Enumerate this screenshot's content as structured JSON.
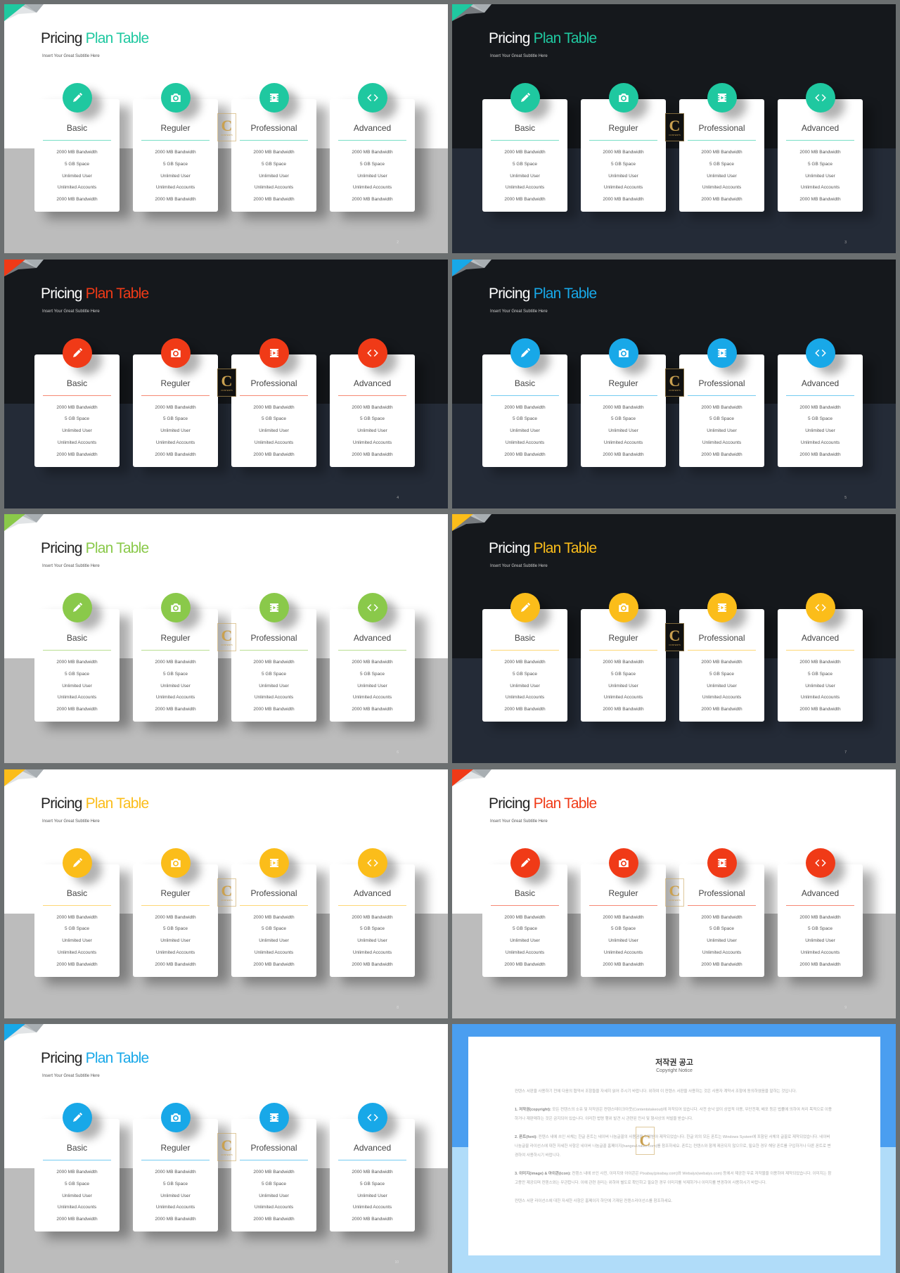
{
  "slide_common": {
    "title_part1": "Pricing",
    "title_part2": "Plan Table",
    "subtitle": "Insert Your Great Subtitle Here",
    "watermark_letter": "C",
    "watermark_text": "CONTENTS",
    "plans": [
      {
        "name": "Basic",
        "icon": "pencil-icon",
        "features": [
          "2000 MB Bandwidth",
          "5 GB Space",
          "Unlimited User",
          "Unlimited Accounts",
          "2000 MB Bandwidth"
        ]
      },
      {
        "name": "Reguler",
        "icon": "camera-icon",
        "features": [
          "2000 MB Bandwidth",
          "5 GB Space",
          "Unlimited User",
          "Unlimited Accounts",
          "2000 MB Bandwidth"
        ]
      },
      {
        "name": "Professional",
        "icon": "film-icon",
        "features": [
          "2000 MB Bandwidth",
          "5 GB Space",
          "Unlimited User",
          "Unlimited Accounts",
          "2000 MB Bandwidth"
        ]
      },
      {
        "name": "Advanced",
        "icon": "code-icon",
        "features": [
          "2000 MB Bandwidth",
          "5 GB Space",
          "Unlimited User",
          "Unlimited Accounts",
          "2000 MB Bandwidth"
        ]
      }
    ]
  },
  "slides": [
    {
      "theme": "light",
      "accent": "#1fc8a0",
      "page": "2"
    },
    {
      "theme": "dark",
      "accent": "#1fc8a0",
      "page": "3"
    },
    {
      "theme": "dark",
      "accent": "#f03a17",
      "page": "4"
    },
    {
      "theme": "dark",
      "accent": "#18a8e8",
      "page": "5"
    },
    {
      "theme": "light",
      "accent": "#8ac94a",
      "page": "6"
    },
    {
      "theme": "dark",
      "accent": "#fbbd1a",
      "page": "7"
    },
    {
      "theme": "light",
      "accent": "#fbbd1a",
      "page": "8"
    },
    {
      "theme": "light",
      "accent": "#f03a17",
      "page": "9"
    },
    {
      "theme": "light",
      "accent": "#18a8e8",
      "page": "10"
    }
  ],
  "notice": {
    "title": "저작권 공고",
    "subtitle": "Copyright Notice",
    "intro": "컨텐스 서판을 사용하기 전에 다음의 협약서 조항들을 자세히 읽어 주시기 바랍니다. 위하여 이 컨텐스 서판을 사용하는 것은 사용자 계약서 조항에 동의하였음을 말하는 것입니다.",
    "sections": [
      {
        "heading": "1. 저작권(copyright):",
        "body": "모든 컨텐스의 소유 및 저작권은 컨텐스테이크아웃(Contentstakeout)에 저작되어 있습니다. 사전 승낙 없이 상업적 이용, 무단전재, 배포 등은 법률에 의하여 처리 목적으로 이용하거나 재판매하는 것은 금지되어 있습니다. 이러한 법령 행위 발견 시 관련된 민사 및 형사상의 처벌을 받습니다."
      },
      {
        "heading": "2. 폰트(font):",
        "body": "컨텐스 내에 쓰인 서체는 한글 폰트는 네이버 나눔글꼴의 사용권을 허락받아 제작되었습니다. 한글 외의 모든 폰트는 Windows System에 포함된 서체의 글꼴로 제작되었습니다. 네이버 나눔글꼴 라이선스에 대한 자세한 사항은 네이버 나눔글꼴 홈페이지(hangeul.naver.com)를 참조하세요. 폰트는 컨텐스와 함께 제공되지 않으므로, 필요한 경우 해당 폰트를 구입하거나 다른 폰트로 변경하여 사용하시기 바랍니다."
      },
      {
        "heading": "3. 이미지(image) & 아이콘(icon):",
        "body": "컨텐스 내에 쓰인 사진, 이미지와 아이콘은 Pixabay(pixabay.com)와 Webalys(webalys.com) 등에서 제공한 무료 저작물을 이용하여 제작되었습니다. 이미지는 참고용만 제공되며 컨텐스와는 무관합니다. 이에 관련 권리는 위하여 별도로 확인하고 필요한 경우 이미지를 삭제하거나 이미지를 변경하여 사용하시기 바랍니다."
      }
    ],
    "closing": "컨텐스 서판 라이선스에 대한 자세한 사항은 홈페이지 하단에 기재된 컨텐스라이선스를 참조하세요."
  }
}
